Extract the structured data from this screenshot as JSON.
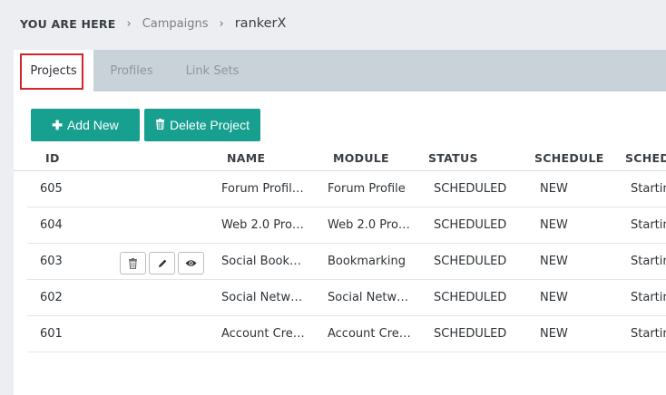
{
  "breadcrumb": {
    "home": "YOU ARE HERE",
    "separator": "›",
    "link": "Campaigns",
    "current": "rankerX"
  },
  "tabs": [
    {
      "label": "Projects",
      "active": true
    },
    {
      "label": "Profiles",
      "active": false
    },
    {
      "label": "Link Sets",
      "active": false
    }
  ],
  "toolbar": {
    "add_label": "Add New",
    "add_icon": "plus-icon",
    "delete_label": "Delete Project",
    "delete_icon": "trash-icon",
    "accent": "#17a08f"
  },
  "table": {
    "headers": [
      "ID",
      "NAME",
      "MODULE",
      "STATUS",
      "SCHEDULE",
      "SCHED"
    ],
    "rows": [
      {
        "id": "605",
        "name": "Forum Profil…",
        "module": "Forum Profile",
        "status": "SCHEDULED",
        "schedule": "NEW",
        "sched": "Startin"
      },
      {
        "id": "604",
        "name": "Web 2.0 Pro…",
        "module": "Web 2.0 Pro…",
        "status": "SCHEDULED",
        "schedule": "NEW",
        "sched": "Startin"
      },
      {
        "id": "603",
        "name": "Social Book…",
        "module": "Bookmarking",
        "status": "SCHEDULED",
        "schedule": "NEW",
        "sched": "Startin"
      },
      {
        "id": "602",
        "name": "Social Netw…",
        "module": "Social Netw…",
        "status": "SCHEDULED",
        "schedule": "NEW",
        "sched": "Startin"
      },
      {
        "id": "601",
        "name": "Account Cre…",
        "module": "Account Cre…",
        "status": "SCHEDULED",
        "schedule": "NEW",
        "sched": "Startin"
      }
    ],
    "row_actions": [
      "trash-icon",
      "pencil-icon",
      "eye-icon"
    ]
  }
}
